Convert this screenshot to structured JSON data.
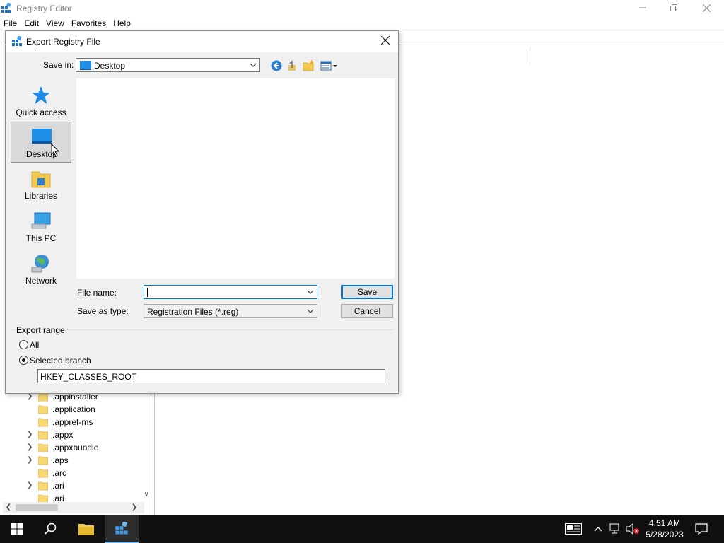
{
  "registry_editor": {
    "title": "Registry Editor",
    "menu": [
      "File",
      "Edit",
      "View",
      "Favorites",
      "Help"
    ],
    "tree_items": [
      {
        "label": ".appinstaller",
        "expandable": true
      },
      {
        "label": ".application",
        "expandable": false
      },
      {
        "label": ".appref-ms",
        "expandable": false
      },
      {
        "label": ".appx",
        "expandable": true
      },
      {
        "label": ".appxbundle",
        "expandable": true
      },
      {
        "label": ".aps",
        "expandable": true
      },
      {
        "label": ".arc",
        "expandable": false
      },
      {
        "label": ".ari",
        "expandable": true
      },
      {
        "label": ".ari",
        "expandable": false
      }
    ]
  },
  "dialog": {
    "title": "Export Registry File",
    "save_in_label": "Save in:",
    "save_in_value": "Desktop",
    "places": [
      {
        "label": "Quick access",
        "icon": "star-icon"
      },
      {
        "label": "Desktop",
        "icon": "desktop-icon",
        "selected": true
      },
      {
        "label": "Libraries",
        "icon": "libraries-icon"
      },
      {
        "label": "This PC",
        "icon": "computer-icon"
      },
      {
        "label": "Network",
        "icon": "network-icon"
      }
    ],
    "file_name_label": "File name:",
    "file_name_value": "",
    "save_as_type_label": "Save as type:",
    "save_as_type_value": "Registration Files (*.reg)",
    "save_button": "Save",
    "cancel_button": "Cancel",
    "export_range": {
      "label": "Export range",
      "all_label": "All",
      "selected_branch_label": "Selected branch",
      "selected": "Selected branch",
      "branch_value": "HKEY_CLASSES_ROOT"
    }
  },
  "taskbar": {
    "time": "4:51 AM",
    "date": "5/28/2023"
  },
  "colors": {
    "accent": "#0078d7",
    "taskbar": "#101010",
    "dialog_bg": "#f0f0f0"
  }
}
